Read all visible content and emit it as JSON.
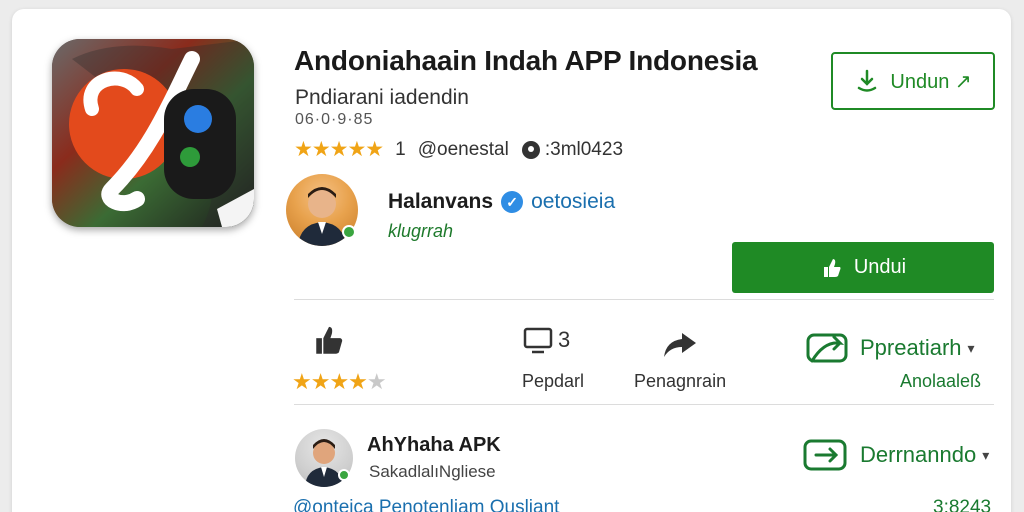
{
  "app": {
    "title": "Andoniahaain Indah APP Indonesia",
    "subtitle": "Pndiarani iadendin",
    "size": "06·0·9·85",
    "rating_stars": "★★★★★",
    "rating_count": "1",
    "handle": "@oenestal",
    "location": ":3ml0423"
  },
  "header_button": {
    "label": "Undun ↗"
  },
  "developer": {
    "name": "Halanvans",
    "verified_tag": "oetosieia",
    "subtitle": "klugrrah"
  },
  "install_button": {
    "label": "Undui"
  },
  "stats": {
    "stars": "★★★★",
    "star_dim": "★",
    "screens_count": "3",
    "screens_label": "Pepdarl",
    "share_label": "Penagnrain",
    "preview_link": "Ppreatiarh",
    "preview_sub": "Anolaaleß"
  },
  "review": {
    "name": "AhYhaha APK",
    "subtitle": "SakadlalıNgliese",
    "action_label": "Derrnanndo"
  },
  "footer": {
    "left_text": "@onteica Penotenliam Ousliant",
    "right_text": "3:8243"
  },
  "colors": {
    "accent_green": "#1f8a25",
    "star_gold": "#f0a416",
    "link_blue": "#1a6fae",
    "verified_blue": "#2f8de4"
  }
}
